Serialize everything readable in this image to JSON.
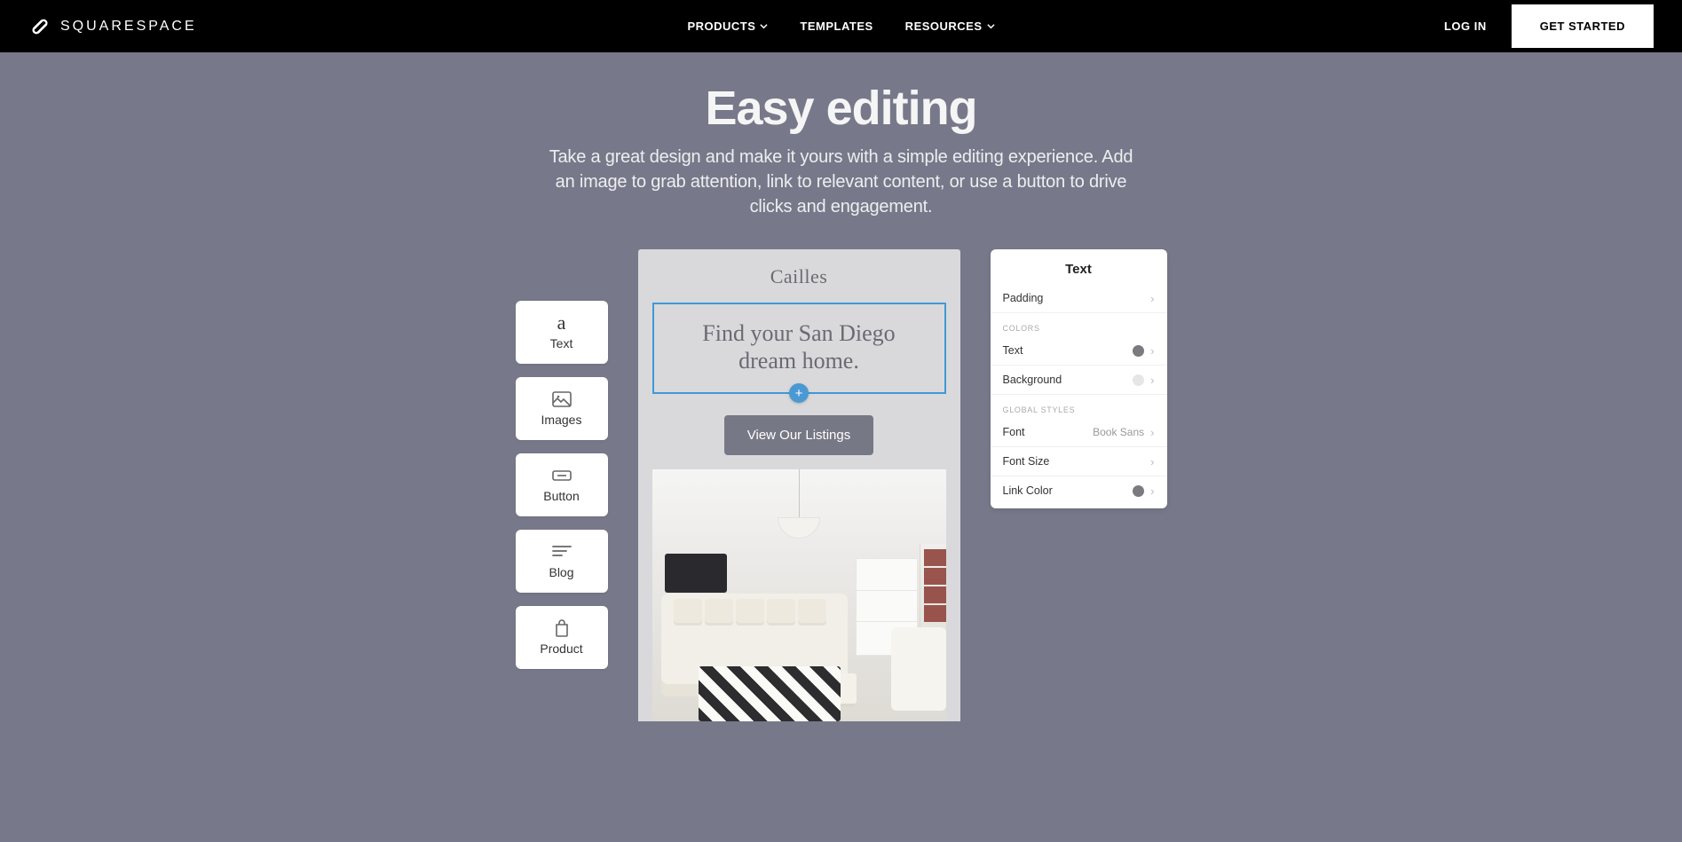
{
  "nav": {
    "brand": "SQUARESPACE",
    "links": {
      "products": "PRODUCTS",
      "templates": "TEMPLATES",
      "resources": "RESOURCES"
    },
    "login": "LOG IN",
    "cta": "GET STARTED"
  },
  "hero": {
    "title": "Easy editing",
    "subtitle": "Take a great design and make it yours with a simple editing experience. Add an image to grab attention, link to relevant content, or use a button to drive clicks and engagement."
  },
  "tools": {
    "text": "Text",
    "images": "Images",
    "button": "Button",
    "blog": "Blog",
    "product": "Product"
  },
  "canvas": {
    "site_title": "Cailles",
    "headline": "Find your San Diego dream home.",
    "cta": "View Our Listings"
  },
  "panel": {
    "title": "Text",
    "padding": "Padding",
    "group_colors": "COLORS",
    "text": "Text",
    "background": "Background",
    "group_global": "GLOBAL STYLES",
    "font": "Font",
    "font_value": "Book Sans",
    "font_size": "Font Size",
    "link_color": "Link Color"
  }
}
